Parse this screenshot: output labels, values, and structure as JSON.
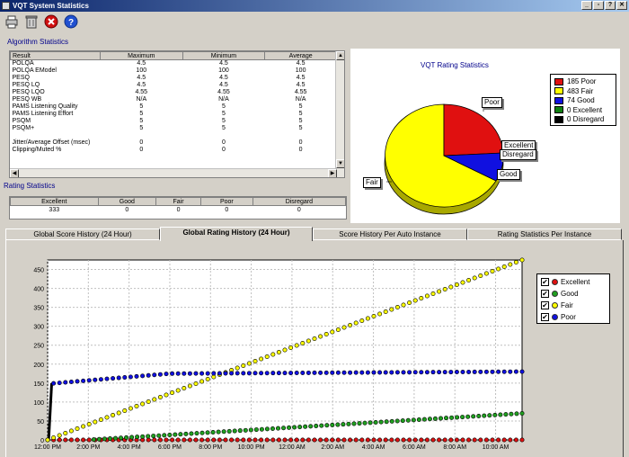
{
  "window": {
    "title": "VQT System Statistics",
    "controls": [
      "_",
      "▫",
      "?",
      "✕"
    ]
  },
  "toolbar": {
    "icons": [
      "print-icon",
      "trash-icon",
      "close-icon",
      "help-icon"
    ]
  },
  "algorithm_statistics": {
    "label": "Algorithm Statistics",
    "headers": [
      "Result",
      "Maximum",
      "Minimum",
      "Average"
    ],
    "rows": [
      [
        "POLQA",
        "4.5",
        "4.5",
        "4.5"
      ],
      [
        "POLQA EModel",
        "100",
        "100",
        "100"
      ],
      [
        "PESQ",
        "4.5",
        "4.5",
        "4.5"
      ],
      [
        "PESQ LQ",
        "4.5",
        "4.5",
        "4.5"
      ],
      [
        "PESQ LQO",
        "4.55",
        "4.55",
        "4.55"
      ],
      [
        "PESQ WB",
        "N/A",
        "N/A",
        "N/A"
      ],
      [
        "PAMS Listening Quality",
        "5",
        "5",
        "5"
      ],
      [
        "PAMS Listening Effort",
        "5",
        "5",
        "5"
      ],
      [
        "PSQM",
        "5",
        "5",
        "5"
      ],
      [
        "PSQM+",
        "5",
        "5",
        "5"
      ],
      [
        "",
        "",
        "",
        ""
      ],
      [
        "Jitter/Average Offset (msec)",
        "0",
        "0",
        "0"
      ],
      [
        "Clipping/Muted %",
        "0",
        "0",
        "0"
      ]
    ]
  },
  "rating_statistics": {
    "label": "Rating Statistics",
    "headers": [
      "Excellent",
      "Good",
      "Fair",
      "Poor",
      "Disregard"
    ],
    "values": [
      "333",
      "0",
      "0",
      "0",
      "0"
    ]
  },
  "vqt_rating": {
    "title": "VQT Rating Statistics",
    "legend": [
      {
        "label": "185 Poor",
        "color": "#e01010"
      },
      {
        "label": "483 Fair",
        "color": "#ffff00"
      },
      {
        "label": "74 Good",
        "color": "#1010e0"
      },
      {
        "label": "0 Excellent",
        "color": "#108010"
      },
      {
        "label": "0 Disregard",
        "color": "#000000"
      }
    ],
    "callouts": [
      "Poor",
      "Excellent",
      "Disregard",
      "Good",
      "Fair"
    ]
  },
  "tabs": [
    "Global Score History (24 Hour)",
    "Global Rating History (24 Hour)",
    "Score History Per Auto Instance",
    "Rating Statistics Per Instance"
  ],
  "chart_data": {
    "type": "scatter",
    "title": "",
    "xlabel": "",
    "ylabel": "",
    "x_ticks": [
      "12:00 PM",
      "2:00 PM",
      "4:00 PM",
      "6:00 PM",
      "8:00 PM",
      "10:00 PM",
      "12:00 AM",
      "2:00 AM",
      "4:00 AM",
      "6:00 AM",
      "8:00 AM",
      "10:00 AM"
    ],
    "y_ticks": [
      0,
      50,
      100,
      150,
      200,
      250,
      300,
      350,
      400,
      450
    ],
    "ylim": [
      0,
      475
    ],
    "x_unit": "hours from 12:00 PM",
    "xlim": [
      0,
      23.3
    ],
    "grid": true,
    "legend_position": "right",
    "series": [
      {
        "name": "Excellent",
        "color": "#e01010",
        "start": [
          0.0,
          0
        ],
        "end": [
          23.3,
          0
        ]
      },
      {
        "name": "Good",
        "color": "#20a020",
        "start": [
          2.0,
          0
        ],
        "end": [
          23.3,
          70
        ]
      },
      {
        "name": "Fair",
        "color": "#ffff00",
        "start": [
          0.0,
          0
        ],
        "end": [
          23.3,
          475
        ]
      },
      {
        "name": "Poor",
        "color": "#1010e0",
        "start": [
          0.0,
          0
        ],
        "end": [
          23.3,
          180
        ]
      }
    ]
  }
}
